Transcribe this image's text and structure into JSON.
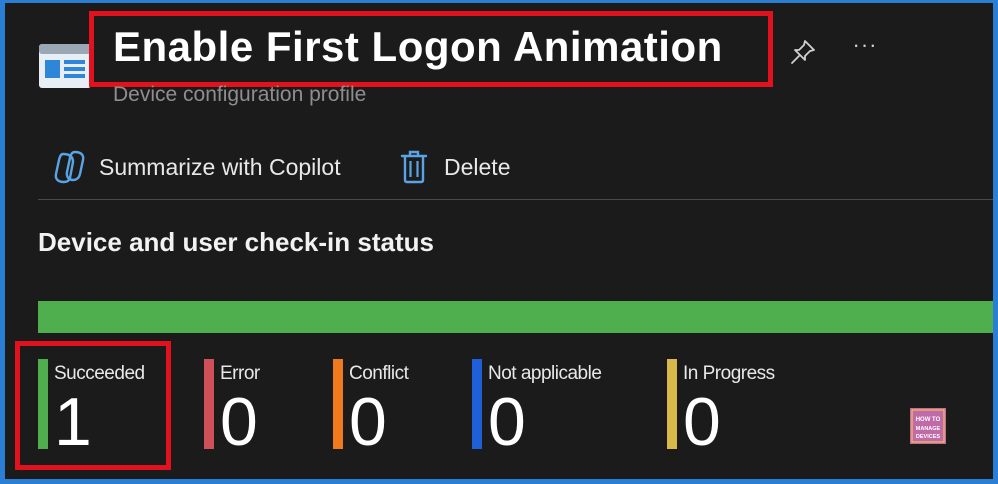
{
  "header": {
    "title": "Enable First Logon Animation",
    "subtitle": "Device configuration profile",
    "icons": {
      "profile": "profile-document-icon",
      "pin": "pin-icon",
      "more": "more-icon"
    },
    "more_glyph": "···"
  },
  "toolbar": {
    "copilot_label": "Summarize with Copilot",
    "delete_label": "Delete",
    "icons": {
      "copilot": "copilot-icon",
      "delete": "trash-icon"
    }
  },
  "status": {
    "section_title": "Device and user check-in status",
    "bar_succeeded_fraction": 1.0,
    "items": [
      {
        "label": "Succeeded",
        "value": "1",
        "color": "#4faf4f"
      },
      {
        "label": "Error",
        "value": "0",
        "color": "#d0505a"
      },
      {
        "label": "Conflict",
        "value": "0",
        "color": "#f07a1e"
      },
      {
        "label": "Not applicable",
        "value": "0",
        "color": "#1f5fd8"
      },
      {
        "label": "In Progress",
        "value": "0",
        "color": "#d9b94a"
      }
    ]
  },
  "watermark": {
    "top": "HOW TO",
    "bottom": "MANAGE DEVICES"
  },
  "colors": {
    "background": "#1b1b1b",
    "frame": "#2a7fd4",
    "highlight": "#e1121d",
    "accent_blue": "#5aa4e6",
    "status_bar": "#4faf4f"
  }
}
